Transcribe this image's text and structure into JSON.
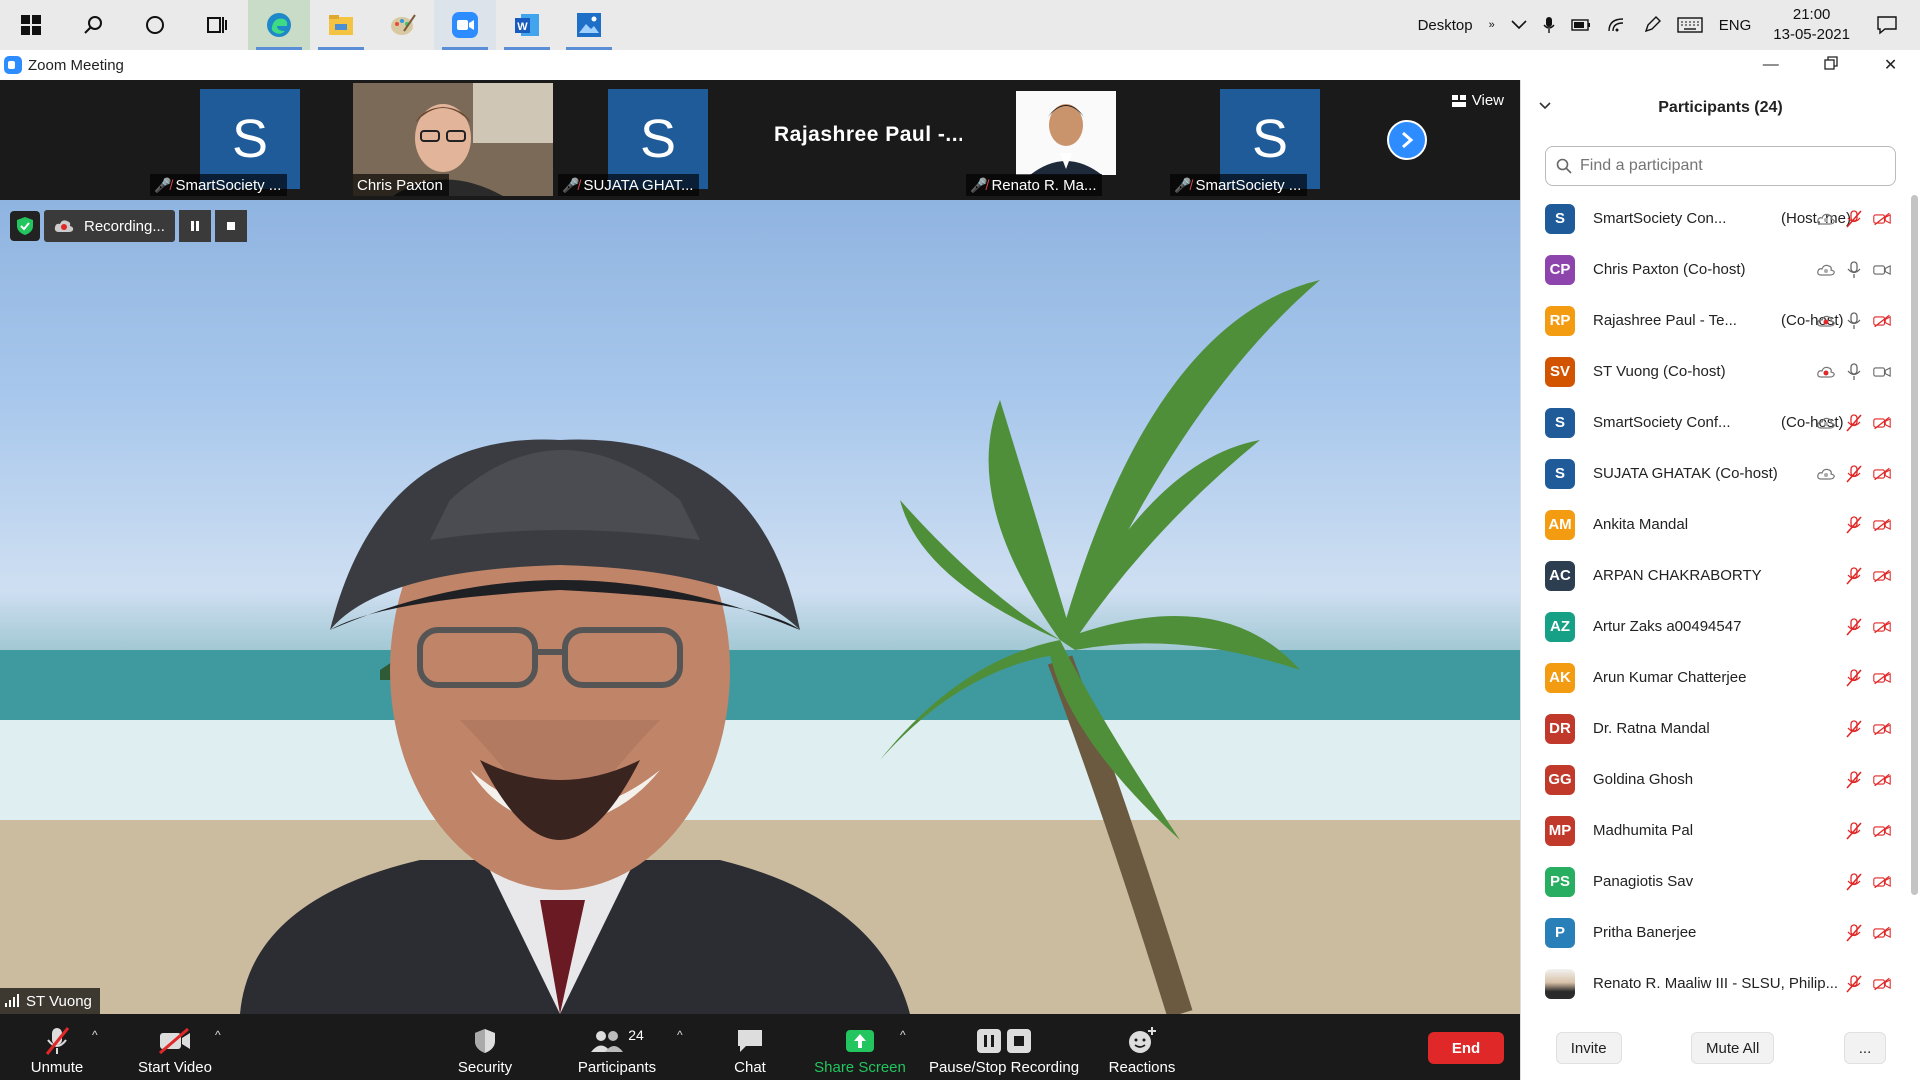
{
  "taskbar": {
    "desktop_label": "Desktop",
    "language": "ENG",
    "time": "21:00",
    "date": "13-05-2021",
    "apps": [
      "windows-start-icon",
      "search-icon",
      "cortana-icon",
      "task-view-icon",
      "edge-icon",
      "file-explorer-icon",
      "paint-icon",
      "zoom-icon",
      "word-icon",
      "photos-icon"
    ]
  },
  "window": {
    "title": "Zoom Meeting"
  },
  "strip": {
    "view_label": "View",
    "thumbs": [
      {
        "name": "SmartSociety ...",
        "tile": "S",
        "muted": true
      },
      {
        "name": "Chris Paxton",
        "tile": "",
        "muted": false
      },
      {
        "name": "SUJATA GHAT...",
        "tile": "S",
        "muted": true
      },
      {
        "name": "Rajashree Paul -...",
        "tile": "",
        "muted": false
      },
      {
        "name": "Renato R. Ma...",
        "tile": "",
        "muted": true
      },
      {
        "name": "SmartSociety ...",
        "tile": "S",
        "muted": true
      }
    ]
  },
  "video": {
    "recording_label": "Recording...",
    "speaker_name": "ST Vuong"
  },
  "toolbar": {
    "unmute": "Unmute",
    "start_video": "Start Video",
    "security": "Security",
    "participants": "Participants",
    "participants_count": "24",
    "chat": "Chat",
    "share_screen": "Share Screen",
    "pause_stop_recording": "Pause/Stop Recording",
    "reactions": "Reactions",
    "end": "End"
  },
  "panel": {
    "title": "Participants (24)",
    "search_placeholder": "Find a participant",
    "invite": "Invite",
    "mute_all": "Mute All",
    "more": "...",
    "participants": [
      {
        "initials": "S",
        "color": "#1f5b98",
        "name": "SmartSociety Con...",
        "role": "(Host, me)",
        "rec": true,
        "mic": "muted",
        "cam": "off"
      },
      {
        "initials": "CP",
        "color": "#8e44ad",
        "name": "Chris Paxton (Co-host)",
        "role": "",
        "rec": true,
        "mic": "on",
        "cam": "on"
      },
      {
        "initials": "RP",
        "color": "#f39c12",
        "name": "Rajashree Paul - Te...",
        "role": "(Co-host)",
        "rec": "active",
        "mic": "on",
        "cam": "off"
      },
      {
        "initials": "SV",
        "color": "#d35400",
        "name": "ST Vuong (Co-host)",
        "role": "",
        "rec": "active",
        "mic": "on",
        "cam": "on"
      },
      {
        "initials": "S",
        "color": "#1f5b98",
        "name": "SmartSociety Conf...",
        "role": "(Co-host)",
        "rec": true,
        "mic": "muted",
        "cam": "off"
      },
      {
        "initials": "S",
        "color": "#1f5b98",
        "name": "SUJATA GHATAK (Co-host)",
        "role": "",
        "rec": true,
        "mic": "muted",
        "cam": "off"
      },
      {
        "initials": "AM",
        "color": "#f39c12",
        "name": "Ankita Mandal",
        "role": "",
        "rec": false,
        "mic": "muted",
        "cam": "off"
      },
      {
        "initials": "AC",
        "color": "#2c3e50",
        "name": "ARPAN CHAKRABORTY",
        "role": "",
        "rec": false,
        "mic": "muted",
        "cam": "off"
      },
      {
        "initials": "AZ",
        "color": "#16a085",
        "name": "Artur Zaks a00494547",
        "role": "",
        "rec": false,
        "mic": "muted",
        "cam": "off"
      },
      {
        "initials": "AK",
        "color": "#f39c12",
        "name": "Arun Kumar Chatterjee",
        "role": "",
        "rec": false,
        "mic": "muted",
        "cam": "off"
      },
      {
        "initials": "DR",
        "color": "#c0392b",
        "name": "Dr. Ratna Mandal",
        "role": "",
        "rec": false,
        "mic": "muted",
        "cam": "off"
      },
      {
        "initials": "GG",
        "color": "#c0392b",
        "name": "Goldina Ghosh",
        "role": "",
        "rec": false,
        "mic": "muted",
        "cam": "off"
      },
      {
        "initials": "MP",
        "color": "#c0392b",
        "name": "Madhumita Pal",
        "role": "",
        "rec": false,
        "mic": "muted",
        "cam": "off"
      },
      {
        "initials": "PS",
        "color": "#27ae60",
        "name": "Panagiotis Sav",
        "role": "",
        "rec": false,
        "mic": "muted",
        "cam": "off"
      },
      {
        "initials": "P",
        "color": "#2980b9",
        "name": "Pritha Banerjee",
        "role": "",
        "rec": false,
        "mic": "muted",
        "cam": "off"
      },
      {
        "initials": "",
        "color": "photo",
        "name": "Renato R. Maaliw III - SLSU, Philip...",
        "role": "",
        "rec": false,
        "mic": "muted",
        "cam": "off"
      }
    ]
  }
}
